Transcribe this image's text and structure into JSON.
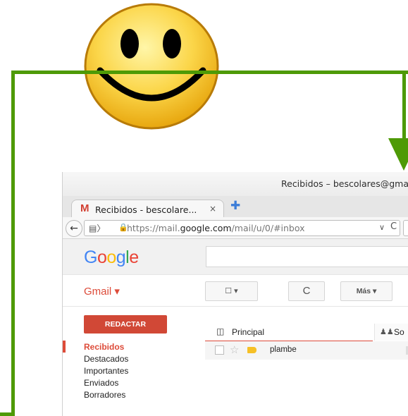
{
  "window": {
    "title": "Recibidos – bescolares@gma"
  },
  "browser": {
    "tab_label": "Recibidos - bescolare...",
    "tab_close": "×",
    "new_tab": "✚",
    "url_prefix": "https://mail.",
    "url_domain": "google.com",
    "url_path": "/mail/u/0/#inbox"
  },
  "gmail": {
    "logo": [
      "G",
      "o",
      "o",
      "g",
      "l",
      "e"
    ],
    "logo_colors": [
      "#4285f4",
      "#ea4335",
      "#fbbc05",
      "#4285f4",
      "#34a853",
      "#ea4335"
    ],
    "app_menu": "Gmail ▾",
    "toolbar": {
      "select": "☐ ▾",
      "refresh": "C",
      "more": "Más ▾"
    },
    "compose": "REDACTAR",
    "nav": [
      "Recibidos",
      "Destacados",
      "Importantes",
      "Enviados",
      "Borradores"
    ],
    "tabs": {
      "primary": "Principal",
      "social": "So"
    },
    "rows": [
      {
        "sender": "plambe"
      }
    ]
  },
  "colors": {
    "connector": "#4e9a06",
    "gmail_red": "#dd4b39",
    "compose": "#d14836"
  }
}
